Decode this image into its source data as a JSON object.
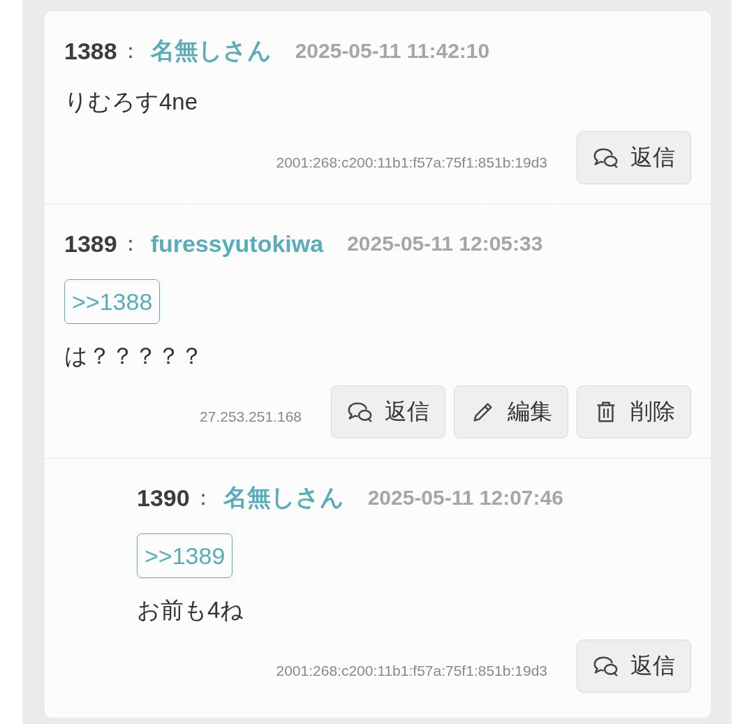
{
  "posts": [
    {
      "number": "1388",
      "separator": "：",
      "name": "名無しさん",
      "date": "2025-05-11 11:42:10",
      "body": "りむろす4ne",
      "ip": "2001:268:c200:11b1:f57a:75f1:851b:19d3",
      "buttons": [
        {
          "kind": "reply",
          "label": "返信"
        }
      ]
    },
    {
      "number": "1389",
      "separator": "：",
      "name": "furessyutokiwa",
      "date": "2025-05-11 12:05:33",
      "anchor": ">>1388",
      "body": "は？？？？？",
      "ip": "27.253.251.168",
      "buttons": [
        {
          "kind": "reply",
          "label": "返信"
        },
        {
          "kind": "edit",
          "label": "編集"
        },
        {
          "kind": "delete",
          "label": "削除"
        }
      ],
      "children": [
        {
          "number": "1390",
          "separator": "：",
          "name": "名無しさん",
          "date": "2025-05-11 12:07:46",
          "anchor": ">>1389",
          "body": "お前も4ね",
          "ip": "2001:268:c200:11b1:f57a:75f1:851b:19d3",
          "buttons": [
            {
              "kind": "reply",
              "label": "返信"
            }
          ]
        }
      ]
    }
  ]
}
